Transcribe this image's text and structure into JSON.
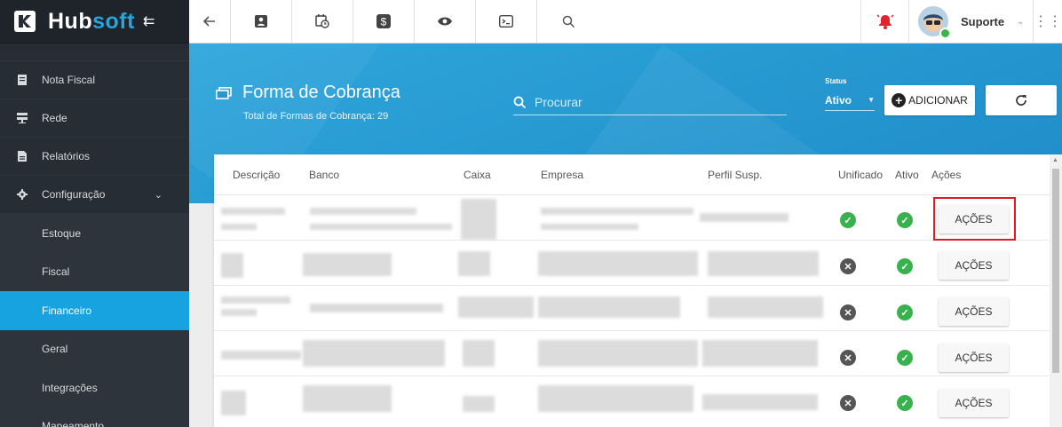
{
  "brand": {
    "name_a": "Hub",
    "name_b": "soft"
  },
  "sidebar": {
    "items": [
      {
        "label": "Nota Fiscal",
        "icon": "invoice-icon"
      },
      {
        "label": "Rede",
        "icon": "network-icon"
      },
      {
        "label": "Relatórios",
        "icon": "report-icon"
      },
      {
        "label": "Configuração",
        "icon": "gear-icon"
      }
    ],
    "submenu": [
      {
        "label": "Estoque"
      },
      {
        "label": "Fiscal"
      },
      {
        "label": "Financeiro",
        "active": true
      },
      {
        "label": "Geral"
      },
      {
        "label": "Integrações"
      },
      {
        "label": "Mapeamento"
      }
    ]
  },
  "topbar": {
    "icons": [
      "back-arrow-icon",
      "contact-card-icon",
      "calendar-clock-icon",
      "dollar-icon",
      "eye-icon",
      "terminal-icon",
      "search-icon"
    ],
    "user": "Suporte"
  },
  "page": {
    "title": "Forma de Cobrança",
    "subtitle": "Total de Formas de Cobrança: 29",
    "search_placeholder": "Procurar",
    "status_label": "Status",
    "status_value": "Ativo",
    "add_label": "ADICIONAR"
  },
  "table": {
    "columns": [
      "Descrição",
      "Banco",
      "Caixa",
      "Empresa",
      "Perfil Susp.",
      "Unificado",
      "Ativo",
      "Ações"
    ],
    "rows": [
      {
        "unificado": true,
        "ativo": true,
        "action": "AÇÕES"
      },
      {
        "unificado": false,
        "ativo": true,
        "action": "AÇÕES"
      },
      {
        "unificado": false,
        "ativo": true,
        "action": "AÇÕES"
      },
      {
        "unificado": false,
        "ativo": true,
        "action": "AÇÕES"
      },
      {
        "unificado": false,
        "ativo": true,
        "action": "AÇÕES"
      }
    ]
  },
  "colors": {
    "accent": "#17a3e0",
    "sidebar": "#262d34",
    "ok": "#37b24d",
    "no": "#555555",
    "highlight": "#e01b24"
  }
}
